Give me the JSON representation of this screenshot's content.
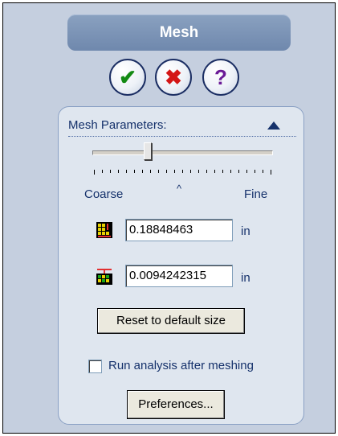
{
  "header": {
    "title": "Mesh"
  },
  "actions": {
    "ok_glyph": "✔",
    "ok_color": "#138a13",
    "cancel_glyph": "✖",
    "cancel_color": "#d41616",
    "help_glyph": "?",
    "help_color": "#6a1a96"
  },
  "mesh": {
    "section_title": "Mesh Parameters:",
    "slider": {
      "level": 0.31,
      "tick_count": 23
    },
    "coarse_label": "Coarse",
    "fine_label": "Fine",
    "caret": "^",
    "global_size_value": "0.18848463",
    "tolerance_value": "0.0094242315",
    "unit": "in",
    "reset_label": "Reset to default size",
    "run_analysis_label": "Run analysis after meshing",
    "run_analysis_checked": false,
    "preferences_label": "Preferences..."
  }
}
